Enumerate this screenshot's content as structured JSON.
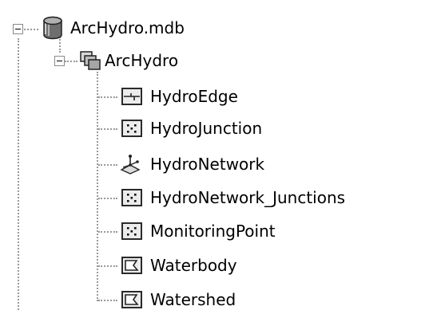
{
  "tree": {
    "database": {
      "label": "ArcHydro.mdb",
      "icon": "database-icon"
    },
    "dataset": {
      "label": "ArcHydro",
      "icon": "feature-dataset-icon"
    },
    "feature_classes": [
      {
        "label": "HydroEdge",
        "icon": "line-feature-class-icon"
      },
      {
        "label": "HydroJunction",
        "icon": "point-feature-class-icon"
      },
      {
        "label": "HydroNetwork",
        "icon": "geometric-network-icon"
      },
      {
        "label": "HydroNetwork_Junctions",
        "icon": "point-feature-class-icon"
      },
      {
        "label": "MonitoringPoint",
        "icon": "point-feature-class-icon"
      },
      {
        "label": "Waterbody",
        "icon": "polygon-feature-class-icon"
      },
      {
        "label": "Watershed",
        "icon": "polygon-feature-class-icon"
      }
    ]
  }
}
